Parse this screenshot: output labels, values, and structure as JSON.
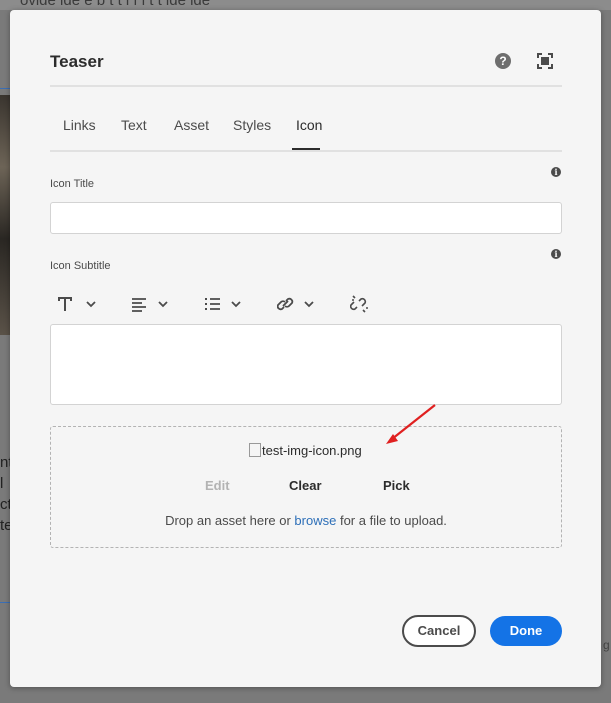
{
  "background": {
    "top_snippet": "ovide  ide  e    b   t  t   i  f  i   t   t    ide  ide",
    "left_text_lines": [
      "nt",
      "l",
      "ct",
      "te"
    ],
    "right_snippet": "g"
  },
  "dialog": {
    "title": "Teaser",
    "help_label": "?",
    "tabs": [
      {
        "label": "Links"
      },
      {
        "label": "Text"
      },
      {
        "label": "Asset"
      },
      {
        "label": "Styles"
      },
      {
        "label": "Icon"
      }
    ],
    "selected_tab": "Icon",
    "icon_title": {
      "label": "Icon Title",
      "value": "",
      "info_icon": "info-icon"
    },
    "icon_subtitle": {
      "label": "Icon Subtitle",
      "value": "",
      "info_icon": "info-icon"
    },
    "rte_toolbar": [
      "paragraph-format-icon",
      "justify-icon",
      "list-icon",
      "link-icon",
      "unlink-icon"
    ],
    "asset": {
      "image_alt": "test-img-icon.png",
      "edit_label": "Edit",
      "clear_label": "Clear",
      "pick_label": "Pick",
      "hint_before": "Drop an asset here or ",
      "hint_link": "browse",
      "hint_after": " for a file to upload."
    },
    "cancel_label": "Cancel",
    "done_label": "Done"
  },
  "colors": {
    "accent": "#1473e6",
    "link": "#2d6fb8",
    "annotation_arrow": "#e02020"
  }
}
